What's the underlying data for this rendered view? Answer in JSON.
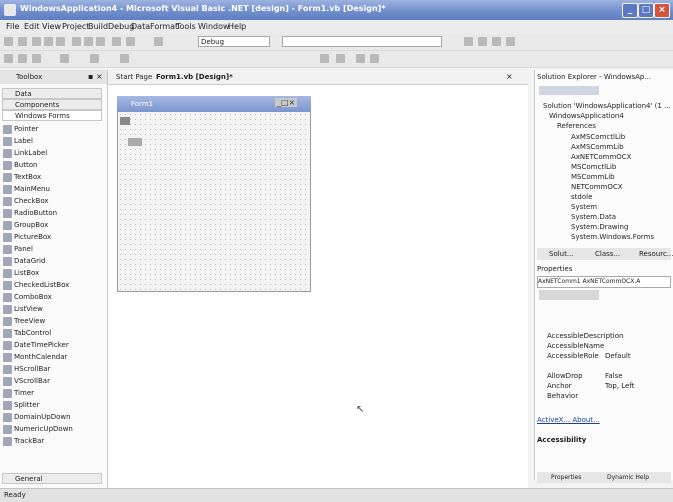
{
  "title": "WindowsApplication4 - Microsoft Visual Basic .NET [design] - Form1.vb [Design]*",
  "menu": [
    "File",
    "Edit",
    "View",
    "Project",
    "Build",
    "Debug",
    "Data",
    "Format",
    "Tools",
    "Window",
    "Help"
  ],
  "toolbar": {
    "config": "Debug"
  },
  "toolbox": {
    "title": "Toolbox",
    "tabs": [
      "Data",
      "Components",
      "Windows Forms"
    ],
    "items": [
      "Pointer",
      "Label",
      "LinkLabel",
      "Button",
      "TextBox",
      "MainMenu",
      "CheckBox",
      "RadioButton",
      "GroupBox",
      "PictureBox",
      "Panel",
      "DataGrid",
      "ListBox",
      "CheckedListBox",
      "ComboBox",
      "ListView",
      "TreeView",
      "TabControl",
      "DateTimePicker",
      "MonthCalendar",
      "HScrollBar",
      "VScrollBar",
      "Timer",
      "Splitter",
      "DomainUpDown",
      "NumericUpDown",
      "TrackBar"
    ],
    "footer": "General"
  },
  "doc": {
    "tabs": [
      "Start Page",
      "Form1.vb [Design]*"
    ],
    "form_title": "Form1"
  },
  "solution": {
    "title": "Solution Explorer - WindowsAp...",
    "items": [
      "Solution 'WindowsApplication4' (1 ...",
      "WindowsApplication4",
      "References",
      "AxMSComctlLib",
      "AxMSCommLib",
      "AxNETCommOCX",
      "MSComctlLib",
      "MSCommLib",
      "NETCommOCX",
      "stdole",
      "System",
      "System.Data",
      "System.Drawing",
      "System.Windows.Forms"
    ],
    "tabs": [
      "Solut...",
      "Class...",
      "Resourc..."
    ]
  },
  "properties": {
    "title": "Properties",
    "object": "AxNETComm1 AxNETCommOCX.A",
    "rows": [
      [
        "AccessibleDescription",
        ""
      ],
      [
        "AccessibleName",
        ""
      ],
      [
        "AccessibleRole",
        "Default"
      ],
      [
        "AllowDrop",
        "False"
      ],
      [
        "Anchor",
        "Top, Left"
      ],
      [
        "Behavior",
        ""
      ]
    ],
    "links": "ActiveX... About...",
    "section": "Accessibility",
    "bottom_tabs": [
      "Properties",
      "Dynamic Help"
    ]
  },
  "status": "Ready"
}
